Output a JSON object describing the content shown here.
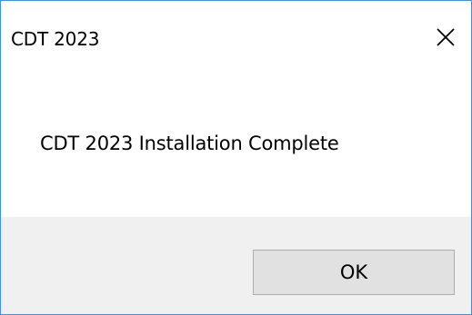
{
  "dialog": {
    "title": "CDT 2023",
    "close_icon": "close-icon",
    "message": "CDT 2023 Installation Complete",
    "ok_label": "OK"
  },
  "colors": {
    "window_border": "#4a8ed8",
    "footer_background": "#f0f0f0",
    "button_background": "#e1e1e1",
    "button_border": "#adadad"
  }
}
